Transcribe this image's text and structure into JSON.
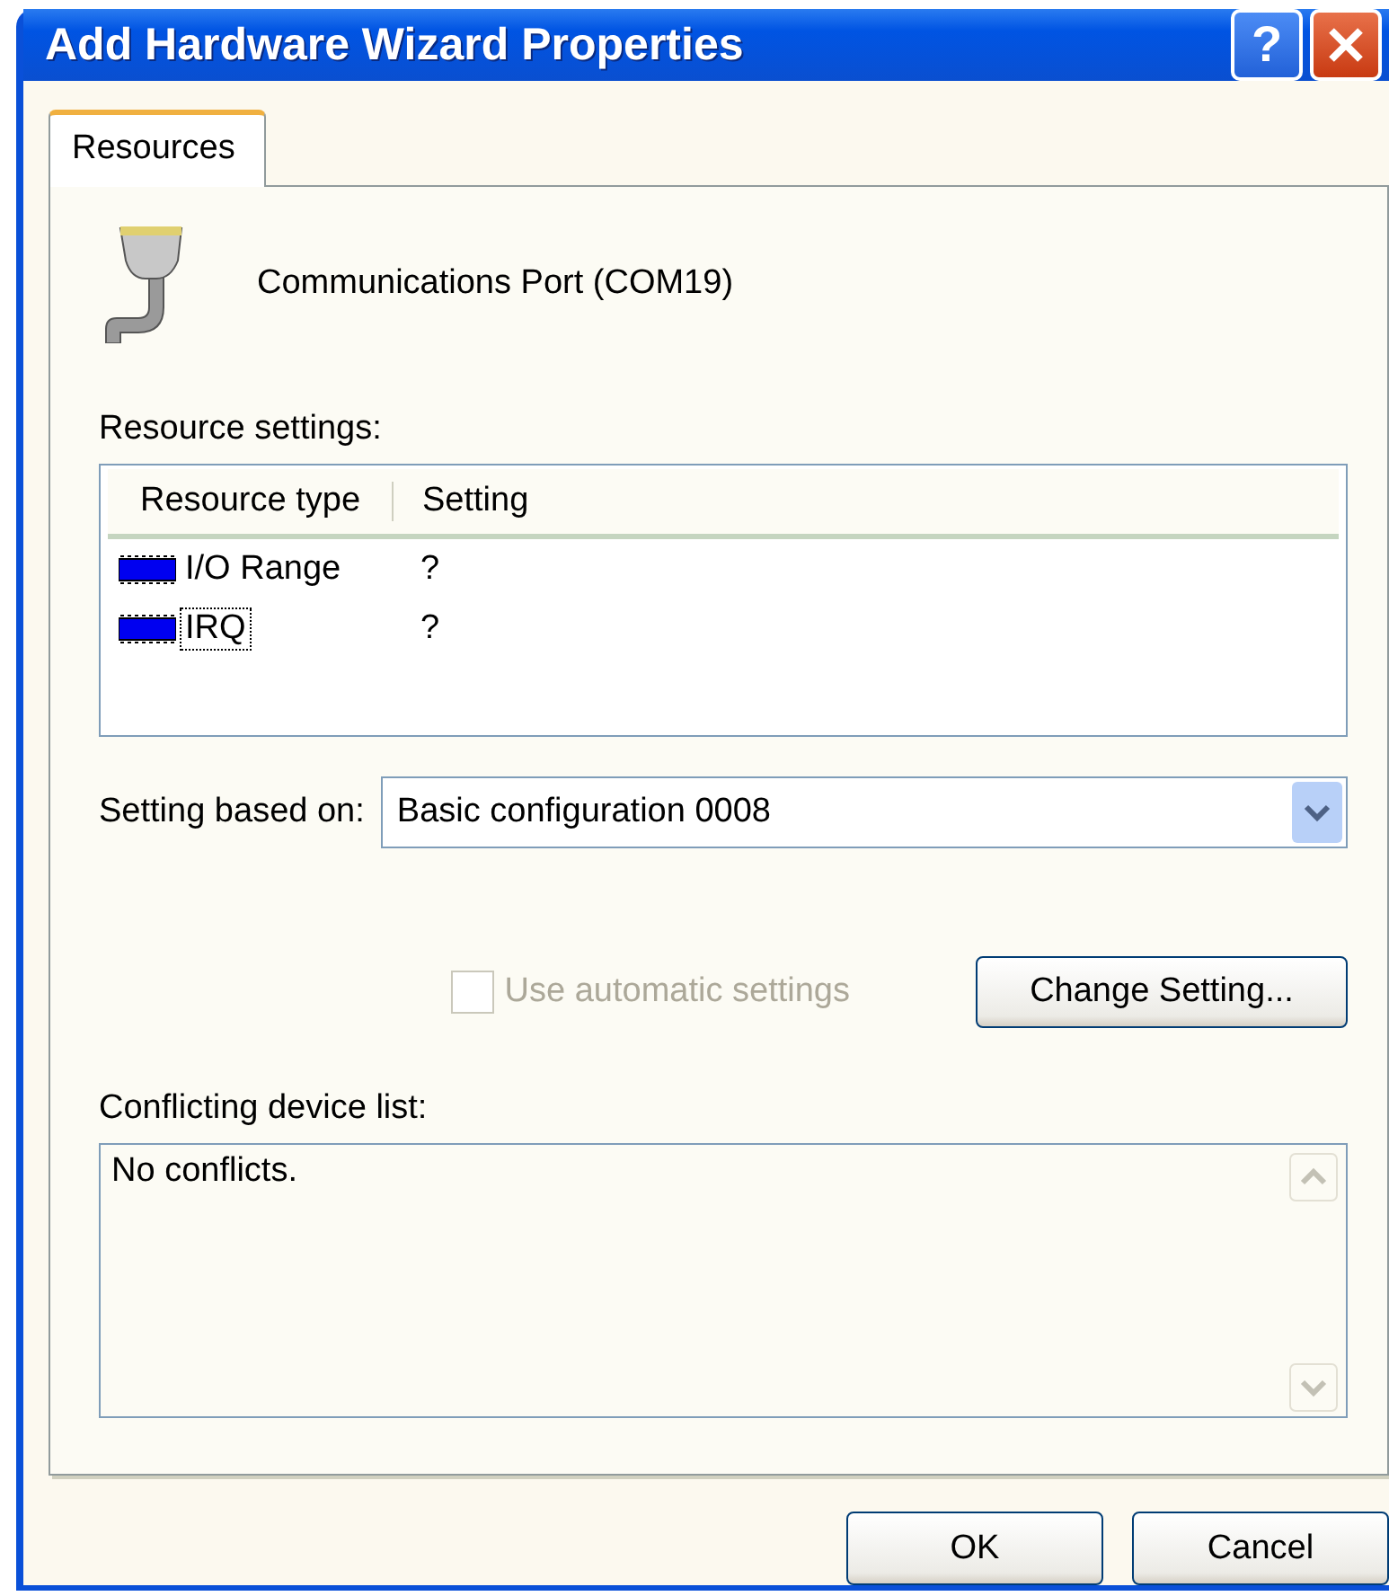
{
  "window": {
    "title": "Add Hardware Wizard Properties",
    "help_button": "?"
  },
  "tabs": [
    {
      "label": "Resources",
      "selected": true
    }
  ],
  "device": {
    "name": "Communications Port (COM19)"
  },
  "resource_settings": {
    "label": "Resource settings:",
    "columns": [
      "Resource type",
      "Setting"
    ],
    "rows": [
      {
        "type": "I/O Range",
        "setting": "?",
        "focused": false
      },
      {
        "type": "IRQ",
        "setting": "?",
        "focused": true
      }
    ]
  },
  "setting_based_on": {
    "label": "Setting based on:",
    "value": "Basic configuration 0008"
  },
  "use_automatic": {
    "label": "Use automatic settings",
    "checked": false,
    "disabled": true
  },
  "change_button": "Change Setting...",
  "conflicts": {
    "label": "Conflicting device list:",
    "text": "No conflicts."
  },
  "buttons": [
    "OK",
    "Cancel"
  ]
}
